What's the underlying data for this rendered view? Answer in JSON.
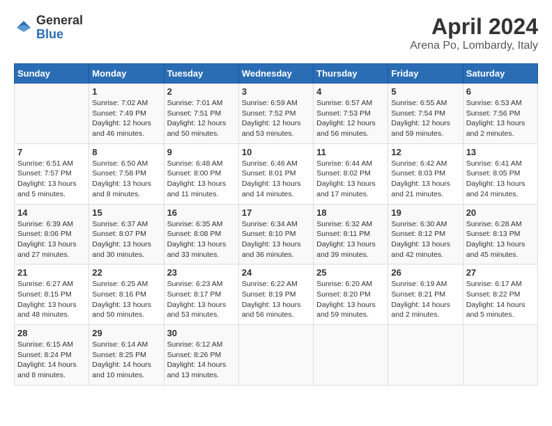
{
  "header": {
    "logo_general": "General",
    "logo_blue": "Blue",
    "month_title": "April 2024",
    "subtitle": "Arena Po, Lombardy, Italy"
  },
  "days_of_week": [
    "Sunday",
    "Monday",
    "Tuesday",
    "Wednesday",
    "Thursday",
    "Friday",
    "Saturday"
  ],
  "weeks": [
    [
      {
        "day": "",
        "info": ""
      },
      {
        "day": "1",
        "info": "Sunrise: 7:02 AM\nSunset: 7:49 PM\nDaylight: 12 hours\nand 46 minutes."
      },
      {
        "day": "2",
        "info": "Sunrise: 7:01 AM\nSunset: 7:51 PM\nDaylight: 12 hours\nand 50 minutes."
      },
      {
        "day": "3",
        "info": "Sunrise: 6:59 AM\nSunset: 7:52 PM\nDaylight: 12 hours\nand 53 minutes."
      },
      {
        "day": "4",
        "info": "Sunrise: 6:57 AM\nSunset: 7:53 PM\nDaylight: 12 hours\nand 56 minutes."
      },
      {
        "day": "5",
        "info": "Sunrise: 6:55 AM\nSunset: 7:54 PM\nDaylight: 12 hours\nand 59 minutes."
      },
      {
        "day": "6",
        "info": "Sunrise: 6:53 AM\nSunset: 7:56 PM\nDaylight: 13 hours\nand 2 minutes."
      }
    ],
    [
      {
        "day": "7",
        "info": "Sunrise: 6:51 AM\nSunset: 7:57 PM\nDaylight: 13 hours\nand 5 minutes."
      },
      {
        "day": "8",
        "info": "Sunrise: 6:50 AM\nSunset: 7:58 PM\nDaylight: 13 hours\nand 8 minutes."
      },
      {
        "day": "9",
        "info": "Sunrise: 6:48 AM\nSunset: 8:00 PM\nDaylight: 13 hours\nand 11 minutes."
      },
      {
        "day": "10",
        "info": "Sunrise: 6:46 AM\nSunset: 8:01 PM\nDaylight: 13 hours\nand 14 minutes."
      },
      {
        "day": "11",
        "info": "Sunrise: 6:44 AM\nSunset: 8:02 PM\nDaylight: 13 hours\nand 17 minutes."
      },
      {
        "day": "12",
        "info": "Sunrise: 6:42 AM\nSunset: 8:03 PM\nDaylight: 13 hours\nand 21 minutes."
      },
      {
        "day": "13",
        "info": "Sunrise: 6:41 AM\nSunset: 8:05 PM\nDaylight: 13 hours\nand 24 minutes."
      }
    ],
    [
      {
        "day": "14",
        "info": "Sunrise: 6:39 AM\nSunset: 8:06 PM\nDaylight: 13 hours\nand 27 minutes."
      },
      {
        "day": "15",
        "info": "Sunrise: 6:37 AM\nSunset: 8:07 PM\nDaylight: 13 hours\nand 30 minutes."
      },
      {
        "day": "16",
        "info": "Sunrise: 6:35 AM\nSunset: 8:08 PM\nDaylight: 13 hours\nand 33 minutes."
      },
      {
        "day": "17",
        "info": "Sunrise: 6:34 AM\nSunset: 8:10 PM\nDaylight: 13 hours\nand 36 minutes."
      },
      {
        "day": "18",
        "info": "Sunrise: 6:32 AM\nSunset: 8:11 PM\nDaylight: 13 hours\nand 39 minutes."
      },
      {
        "day": "19",
        "info": "Sunrise: 6:30 AM\nSunset: 8:12 PM\nDaylight: 13 hours\nand 42 minutes."
      },
      {
        "day": "20",
        "info": "Sunrise: 6:28 AM\nSunset: 8:13 PM\nDaylight: 13 hours\nand 45 minutes."
      }
    ],
    [
      {
        "day": "21",
        "info": "Sunrise: 6:27 AM\nSunset: 8:15 PM\nDaylight: 13 hours\nand 48 minutes."
      },
      {
        "day": "22",
        "info": "Sunrise: 6:25 AM\nSunset: 8:16 PM\nDaylight: 13 hours\nand 50 minutes."
      },
      {
        "day": "23",
        "info": "Sunrise: 6:23 AM\nSunset: 8:17 PM\nDaylight: 13 hours\nand 53 minutes."
      },
      {
        "day": "24",
        "info": "Sunrise: 6:22 AM\nSunset: 8:19 PM\nDaylight: 13 hours\nand 56 minutes."
      },
      {
        "day": "25",
        "info": "Sunrise: 6:20 AM\nSunset: 8:20 PM\nDaylight: 13 hours\nand 59 minutes."
      },
      {
        "day": "26",
        "info": "Sunrise: 6:19 AM\nSunset: 8:21 PM\nDaylight: 14 hours\nand 2 minutes."
      },
      {
        "day": "27",
        "info": "Sunrise: 6:17 AM\nSunset: 8:22 PM\nDaylight: 14 hours\nand 5 minutes."
      }
    ],
    [
      {
        "day": "28",
        "info": "Sunrise: 6:15 AM\nSunset: 8:24 PM\nDaylight: 14 hours\nand 8 minutes."
      },
      {
        "day": "29",
        "info": "Sunrise: 6:14 AM\nSunset: 8:25 PM\nDaylight: 14 hours\nand 10 minutes."
      },
      {
        "day": "30",
        "info": "Sunrise: 6:12 AM\nSunset: 8:26 PM\nDaylight: 14 hours\nand 13 minutes."
      },
      {
        "day": "",
        "info": ""
      },
      {
        "day": "",
        "info": ""
      },
      {
        "day": "",
        "info": ""
      },
      {
        "day": "",
        "info": ""
      }
    ]
  ]
}
